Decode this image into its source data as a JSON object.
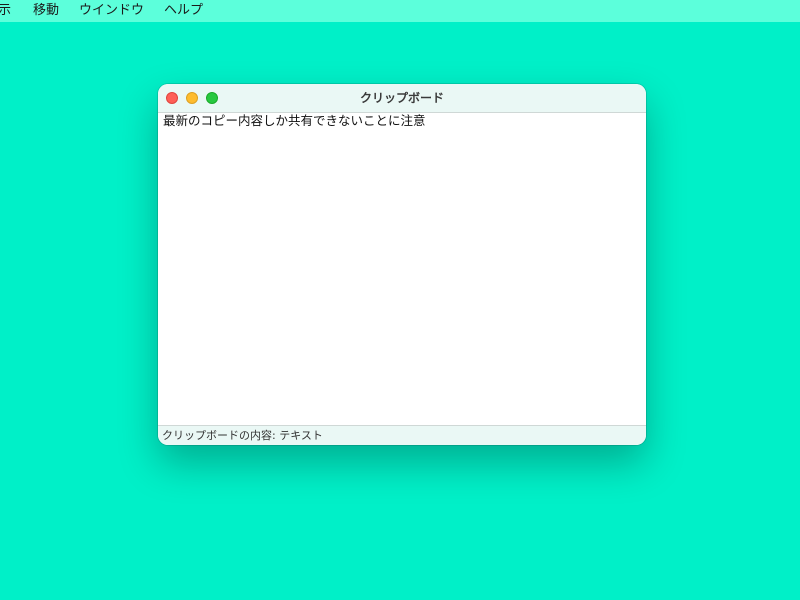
{
  "menubar": {
    "items": [
      {
        "label": "示"
      },
      {
        "label": "移動"
      },
      {
        "label": "ウインドウ"
      },
      {
        "label": "ヘルプ"
      }
    ]
  },
  "window": {
    "title": "クリップボード",
    "content_text": "最新のコピー内容しか共有できないことに注意",
    "status_text": "クリップボードの内容: テキスト"
  },
  "colors": {
    "desktop": "#00f0c8",
    "menubar": "#5cffdb",
    "titlebar": "#eaf8f5",
    "close": "#fe5f57",
    "minimize": "#febc2e",
    "maximize": "#28c840"
  }
}
